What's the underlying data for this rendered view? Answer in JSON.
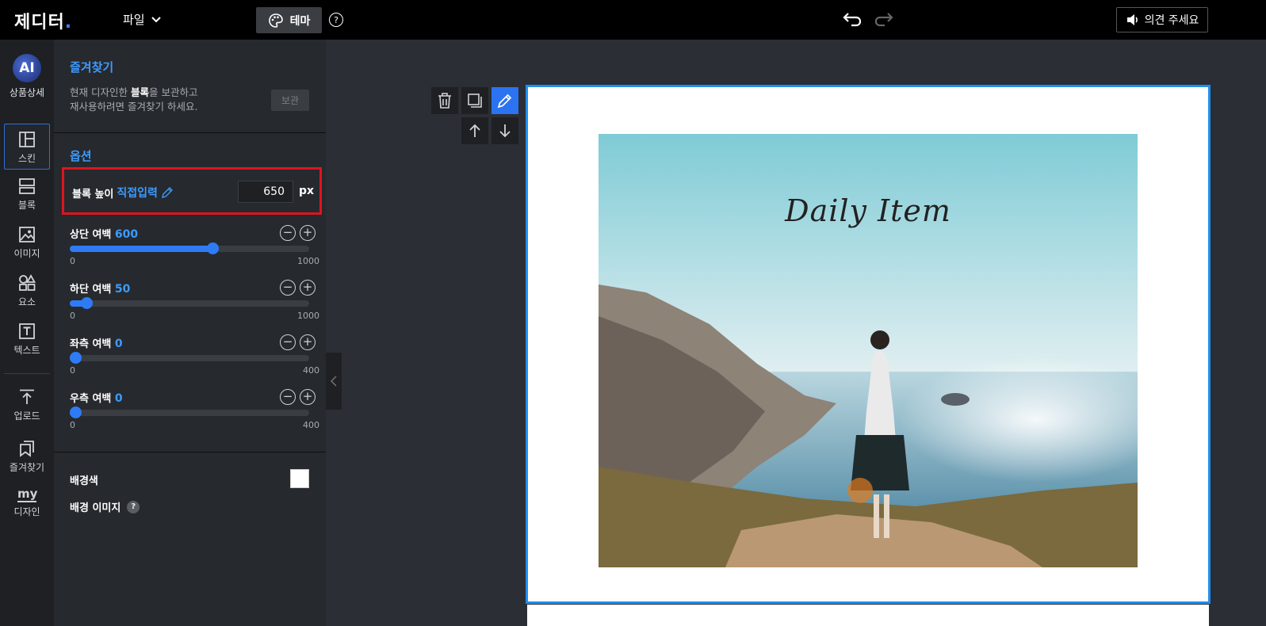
{
  "topbar": {
    "logo": "제디터",
    "file_label": "파일",
    "theme_label": "테마",
    "help": "?",
    "feedback_label": "의견 주세요"
  },
  "iconbar": {
    "ai_badge": "AI",
    "ai_label": "상품상세",
    "items": [
      {
        "label": "스킨",
        "icon": "skin-icon",
        "active": true
      },
      {
        "label": "블록",
        "icon": "block-icon"
      },
      {
        "label": "이미지",
        "icon": "image-icon"
      },
      {
        "label": "요소",
        "icon": "shapes-icon"
      },
      {
        "label": "텍스트",
        "icon": "text-icon"
      },
      {
        "label": "업로드",
        "icon": "upload-icon"
      },
      {
        "label": "즐겨찾기",
        "icon": "bookmark-icon"
      },
      {
        "label": "디자인",
        "icon": "my-design-icon",
        "badge": "my"
      }
    ]
  },
  "panel": {
    "favorites": {
      "title": "즐겨찾기",
      "desc_prefix": "현재 디자인한 ",
      "desc_bold": "블록",
      "desc_suffix": "을 보관하고",
      "desc_line2": "재사용하려면 즐겨찾기 하세요.",
      "save_label": "보관"
    },
    "options": {
      "title": "옵션",
      "height_label": "블록 높이",
      "height_direct": "직접입력",
      "height_value": "650",
      "height_unit": "px",
      "sliders": [
        {
          "name": "상단 여백",
          "value": 600,
          "min": 0,
          "max": 1000
        },
        {
          "name": "하단 여백",
          "value": 50,
          "min": 0,
          "max": 1000
        },
        {
          "name": "좌측 여백",
          "value": 0,
          "min": 0,
          "max": 400
        },
        {
          "name": "우측 여백",
          "value": 0,
          "min": 0,
          "max": 400
        }
      ],
      "bg_color_label": "배경색",
      "bg_color": "#ffffff",
      "bg_image_label": "배경 이미지",
      "bg_image_help": "?"
    }
  },
  "canvas": {
    "photo_title": "Daily Item"
  },
  "colors": {
    "accent": "#3d9bff",
    "selection": "#1f8ff0",
    "highlight": "#e0141e"
  }
}
